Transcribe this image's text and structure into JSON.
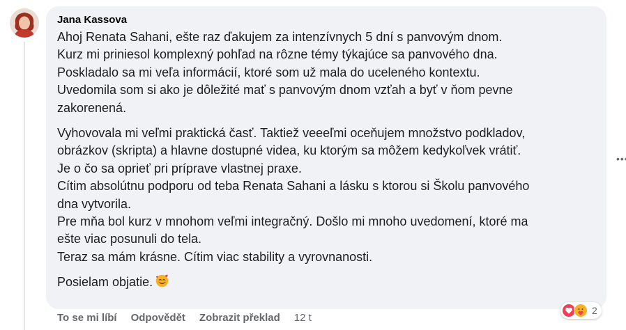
{
  "comment": {
    "author": "Jana Kassova",
    "paragraphs": [
      [
        "Ahoj Renata Sahani, ešte raz ďakujem za intenzívnych 5 dní s panvovým dnom.",
        "Kurz mi priniesol komplexný pohľad na rôzne témy týkajúce sa panvového dna.",
        "Poskladalo sa mi veľa informácií, ktoré som už mala do uceleného kontextu.",
        "Uvedomila som si ako je dôležité mať s panvovým dnom vzťah a byť v ňom pevne",
        "zakorenená."
      ],
      [
        "Vyhovovala mi veľmi praktická časť. Taktiež veeeľmi oceňujem množstvo podkladov,",
        "obrázkov (skripta) a hlavne dostupné videa, ku ktorým sa môžem kedykoľvek vrátiť.",
        "Je o čo sa oprieť pri príprave vlastnej praxe.",
        "Cítim absolútnu podporu od teba Renata Sahani a lásku s ktorou si Školu panvového",
        "dna vytvorila.",
        "Pre mňa bol kurz v mnohom veľmi integračný. Došlo mi mnoho uvedomení, ktoré ma",
        "ešte viac posunuli do tela.",
        "Teraz sa mám krásne. Cítim viac stability a vyrovnanosti."
      ]
    ],
    "closing": "Posielam objatie.",
    "actions": {
      "like": "To se mi líbí",
      "reply": "Odpovědět",
      "translate": "Zobrazit překlad",
      "time": "12 t"
    },
    "reactions": {
      "count": "2",
      "icons": [
        "heart-icon",
        "care-icon"
      ]
    },
    "more_icon": "more-options-icon"
  },
  "colors": {
    "bubble": "#f0f2f5",
    "heart": "#f33e58",
    "care_face": "#f7b125"
  }
}
